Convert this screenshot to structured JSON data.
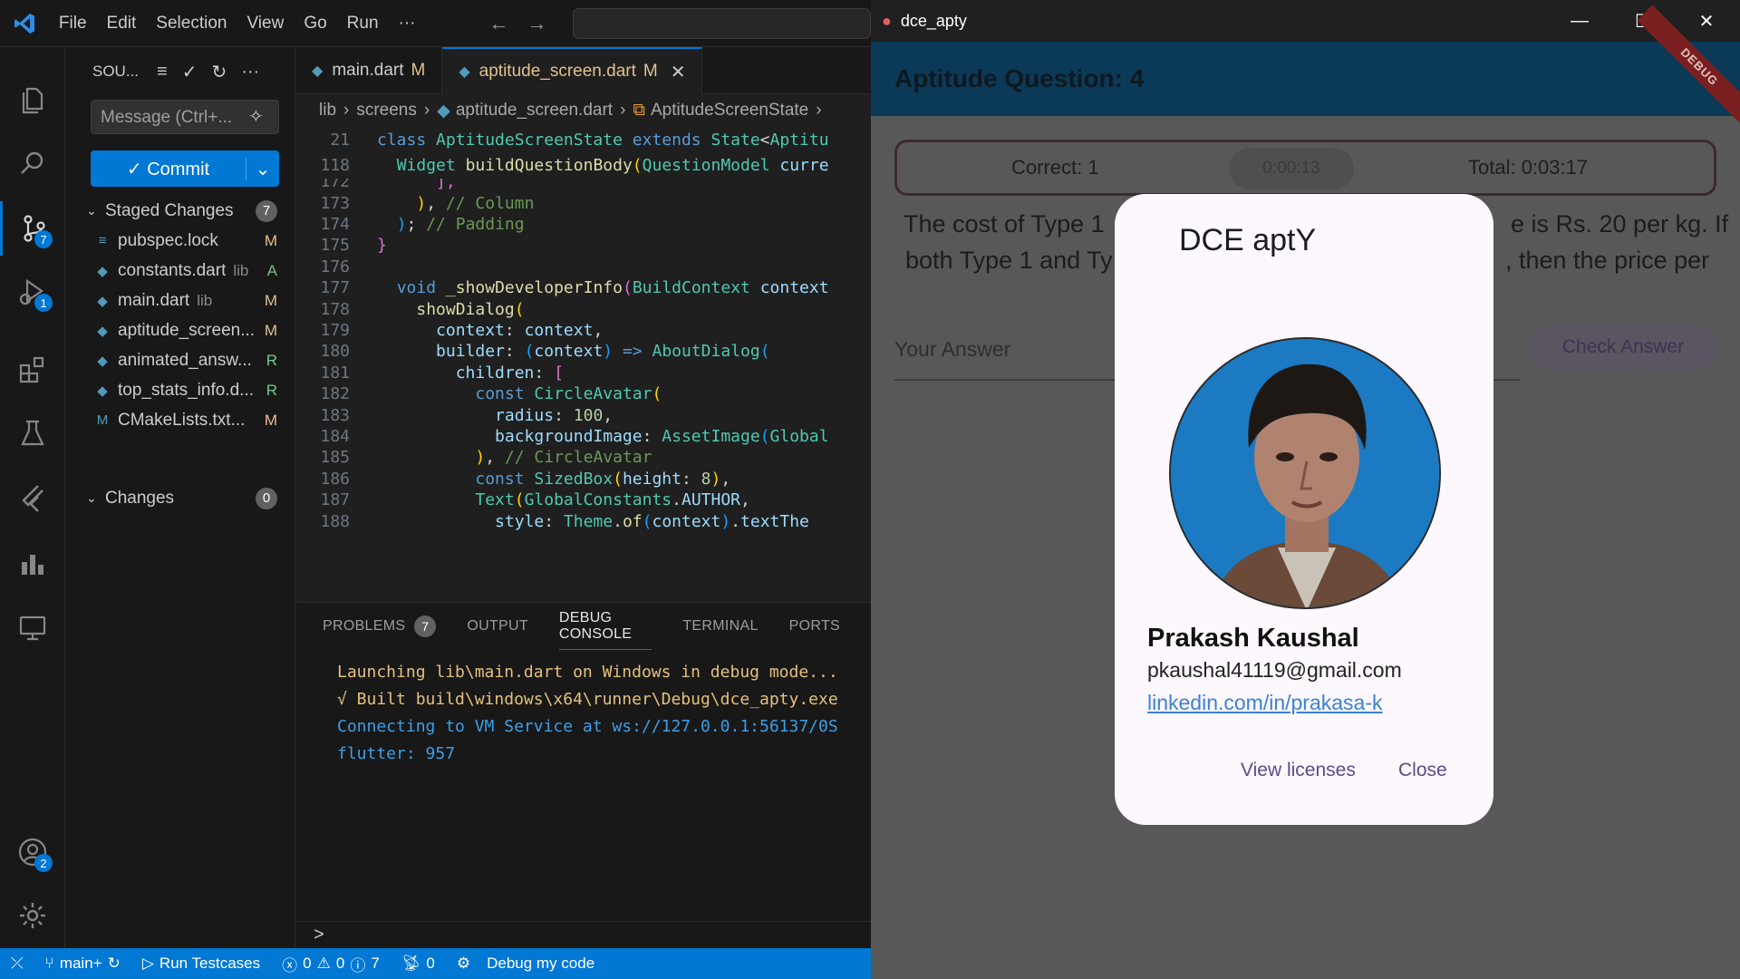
{
  "vscode": {
    "menu": [
      "File",
      "Edit",
      "Selection",
      "View",
      "Go",
      "Run",
      "···"
    ],
    "activity_badges": {
      "scm": "7",
      "debug": "1",
      "accounts": "2"
    },
    "scm": {
      "title": "SOU...",
      "message_placeholder": "Message (Ctrl+...",
      "commit_label": "✓ Commit",
      "staged_label": "Staged Changes",
      "staged_count": "7",
      "changes_label": "Changes",
      "changes_count": "0",
      "files": [
        {
          "name": "pubspec.lock",
          "dir": "",
          "status": "M",
          "icon": "≡",
          "color": "#e2c08d"
        },
        {
          "name": "constants.dart",
          "dir": "lib",
          "status": "A",
          "icon": "◆",
          "color": "#81b88b"
        },
        {
          "name": "main.dart",
          "dir": "lib",
          "status": "M",
          "icon": "◆",
          "color": "#e2c08d"
        },
        {
          "name": "aptitude_screen...",
          "dir": "",
          "status": "M",
          "icon": "◆",
          "color": "#e2c08d"
        },
        {
          "name": "animated_answ...",
          "dir": "",
          "status": "R",
          "icon": "◆",
          "color": "#73c991"
        },
        {
          "name": "top_stats_info.d...",
          "dir": "",
          "status": "R",
          "icon": "◆",
          "color": "#73c991"
        },
        {
          "name": "CMakeLists.txt...",
          "dir": "",
          "status": "M",
          "icon": "M",
          "color": "#e2c08d"
        }
      ]
    },
    "tabs": [
      {
        "name": "main.dart",
        "mod": "M"
      },
      {
        "name": "aptitude_screen.dart",
        "mod": "M",
        "close": "✕"
      }
    ],
    "breadcrumb": [
      "lib",
      "screens",
      "aptitude_screen.dart",
      "AptitudeScreenState"
    ],
    "sticky_lines": [
      {
        "num": "21",
        "html": "<span class='kw'>class</span> <span class='ty'>AptitudeScreenState</span> <span class='kw'>extends</span> <span class='ty'>State</span><span class='pl'>&lt;</span><span class='ty'>Aptitu</span>"
      },
      {
        "num": "118",
        "html": "  <span class='ty'>Widget</span> <span class='fn'>buildQuestionBody</span><span class='br2'>(</span><span class='ty'>QuestionModel</span> <span class='pr'>curre</span>"
      }
    ],
    "code_lines": [
      {
        "num": "172",
        "html": "      <span class='br1'>],</span>"
      },
      {
        "num": "173",
        "html": "    <span class='br2'>)</span><span class='pl'>,</span> <span class='cm'>// Column</span>"
      },
      {
        "num": "174",
        "html": "  <span class='br3'>)</span><span class='pl'>;</span> <span class='cm'>// Padding</span>"
      },
      {
        "num": "175",
        "html": "<span class='br1'>}</span>"
      },
      {
        "num": "176",
        "html": ""
      },
      {
        "num": "177",
        "html": "  <span class='kw'>void</span> <span class='fn'>_showDeveloperInfo</span><span class='br1'>(</span><span class='ty'>BuildContext</span> <span class='pr'>context</span>"
      },
      {
        "num": "178",
        "html": "    <span class='fn'>showDialog</span><span class='br2'>(</span>"
      },
      {
        "num": "179",
        "html": "      <span class='pr'>context</span><span class='pl'>:</span> <span class='pr'>context</span><span class='pl'>,</span>"
      },
      {
        "num": "180",
        "html": "      <span class='pr'>builder</span><span class='pl'>:</span> <span class='br3'>(</span><span class='pr'>context</span><span class='br3'>)</span> <span class='kw'>=&gt;</span> <span class='ty'>AboutDialog</span><span class='br3'>(</span>"
      },
      {
        "num": "181",
        "html": "        <span class='pr'>children</span><span class='pl'>:</span> <span class='br1'>[</span>"
      },
      {
        "num": "182",
        "html": "          <span class='kw'>const</span> <span class='ty'>CircleAvatar</span><span class='br2'>(</span>"
      },
      {
        "num": "183",
        "html": "            <span class='pr'>radius</span><span class='pl'>:</span> <span class='nm'>100</span><span class='pl'>,</span>"
      },
      {
        "num": "184",
        "html": "            <span class='pr'>backgroundImage</span><span class='pl'>:</span> <span class='ty'>AssetImage</span><span class='br3'>(</span><span class='ty'>Global</span>"
      },
      {
        "num": "185",
        "html": "          <span class='br2'>)</span><span class='pl'>,</span> <span class='cm'>// CircleAvatar</span>"
      },
      {
        "num": "186",
        "html": "          <span class='kw'>const</span> <span class='ty'>SizedBox</span><span class='br2'>(</span><span class='pr'>height</span><span class='pl'>:</span> <span class='nm'>8</span><span class='br2'>)</span><span class='pl'>,</span>"
      },
      {
        "num": "187",
        "html": "          <span class='ty'>Text</span><span class='br2'>(</span><span class='ty'>GlobalConstants</span><span class='pl'>.</span><span class='pr'>AUTHOR</span><span class='pl'>,</span>"
      },
      {
        "num": "188",
        "html": "            <span class='pr'>style</span><span class='pl'>:</span> <span class='ty'>Theme</span><span class='pl'>.</span><span class='fn'>of</span><span class='br3'>(</span><span class='pr'>context</span><span class='br3'>)</span><span class='pl'>.</span><span class='pr'>textThe</span>"
      }
    ],
    "panel_tabs": [
      "PROBLEMS",
      "OUTPUT",
      "DEBUG CONSOLE",
      "TERMINAL",
      "PORTS"
    ],
    "problems_count": "7",
    "console": [
      {
        "text": "Launching lib\\main.dart on Windows in debug mode...",
        "color": "#e5c07b"
      },
      {
        "text": "√ Built build\\windows\\x64\\runner\\Debug\\dce_apty.exe",
        "color": "#e5c07b"
      },
      {
        "text": "Connecting to VM Service at ws://127.0.0.1:56137/0S",
        "color": "#3b9fe8"
      },
      {
        "text": "flutter: 957",
        "color": "#3b9fe8"
      }
    ],
    "panel_prompt": ">",
    "status": {
      "branch": "main+",
      "run_testcases": "Run Testcases",
      "errors": "0",
      "warnings": "0",
      "infos": "7",
      "ports": "0",
      "debug": "Debug my code"
    }
  },
  "app": {
    "window_title": "dce_apty",
    "appbar_title": "Aptitude Question: 4",
    "debug_banner": "DEBUG",
    "correct": "Correct: 1",
    "timer": "0:00:13",
    "total": "Total: 0:03:17",
    "question_left_1": "The cost of Type 1",
    "question_right_1": "e is Rs. 20 per kg. If",
    "question_left_2": "both Type 1 and Ty",
    "question_right_2": ", then the price per",
    "answer_placeholder": "Your Answer",
    "check_answer": "Check Answer",
    "dialog": {
      "title": "DCE aptY",
      "name": "Prakash Kaushal",
      "email": "pkaushal41119@gmail.com",
      "link": "linkedin.com/in/prakasa-k",
      "view_licenses": "View licenses",
      "close": "Close"
    }
  }
}
